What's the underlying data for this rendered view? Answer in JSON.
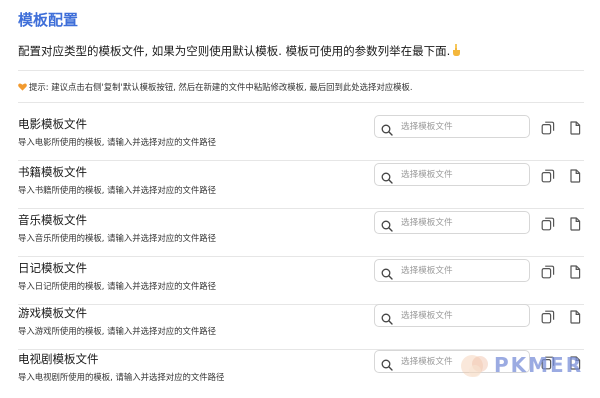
{
  "settings": {
    "heading": "模板配置",
    "intro": "配置对应类型的模板文件, 如果为空则使用默认模板. 模板可使用的参数列举在最下面.",
    "pointer_icon": "hand-pointing-down-icon",
    "tip": "提示: 建议点击右侧'复制'默认模板按钮, 然后在新建的文件中粘贴修改模板, 最后回到此处选择对应模板.",
    "tip_icon": "orange-heart-icon",
    "accent_color": "#3f6fd9",
    "search_placeholder": "选择模板文件",
    "rows": [
      {
        "title": "电影模板文件",
        "desc": "导入电影所使用的模板, 请输入并选择对应的文件路径",
        "value": ""
      },
      {
        "title": "书籍模板文件",
        "desc": "导入书籍所使用的模板, 请输入并选择对应的文件路径",
        "value": ""
      },
      {
        "title": "音乐模板文件",
        "desc": "导入音乐所使用的模板, 请输入并选择对应的文件路径",
        "value": ""
      },
      {
        "title": "日记模板文件",
        "desc": "导入日记所使用的模板, 请输入并选择对应的文件路径",
        "value": ""
      },
      {
        "title": "游戏模板文件",
        "desc": "导入游戏所使用的模板, 请输入并选择对应的文件路径",
        "value": ""
      },
      {
        "title": "电视剧模板文件",
        "desc": "导入电视剧所使用的模板, 请输入并选择对应的文件路径",
        "value": ""
      }
    ]
  },
  "watermark": {
    "text": "PKMER",
    "icon": "pkmer-logo-icon",
    "color": "#7a8fd9"
  }
}
